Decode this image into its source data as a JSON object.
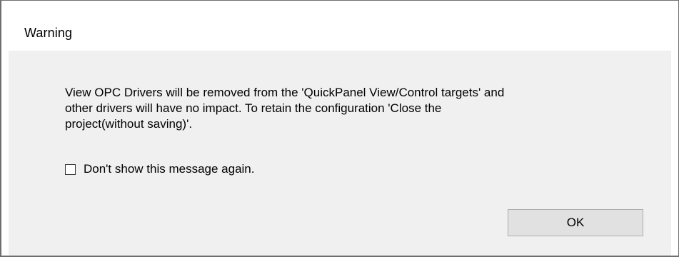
{
  "dialog": {
    "title": "Warning",
    "message_lines": [
      "View OPC Drivers will be removed from the 'QuickPanel View/Control targets' and",
      "other drivers will have no impact. To retain the configuration 'Close the",
      "project(without saving)'."
    ],
    "checkbox": {
      "label": "Don't show this message again.",
      "checked": false
    },
    "ok_label": "OK"
  }
}
